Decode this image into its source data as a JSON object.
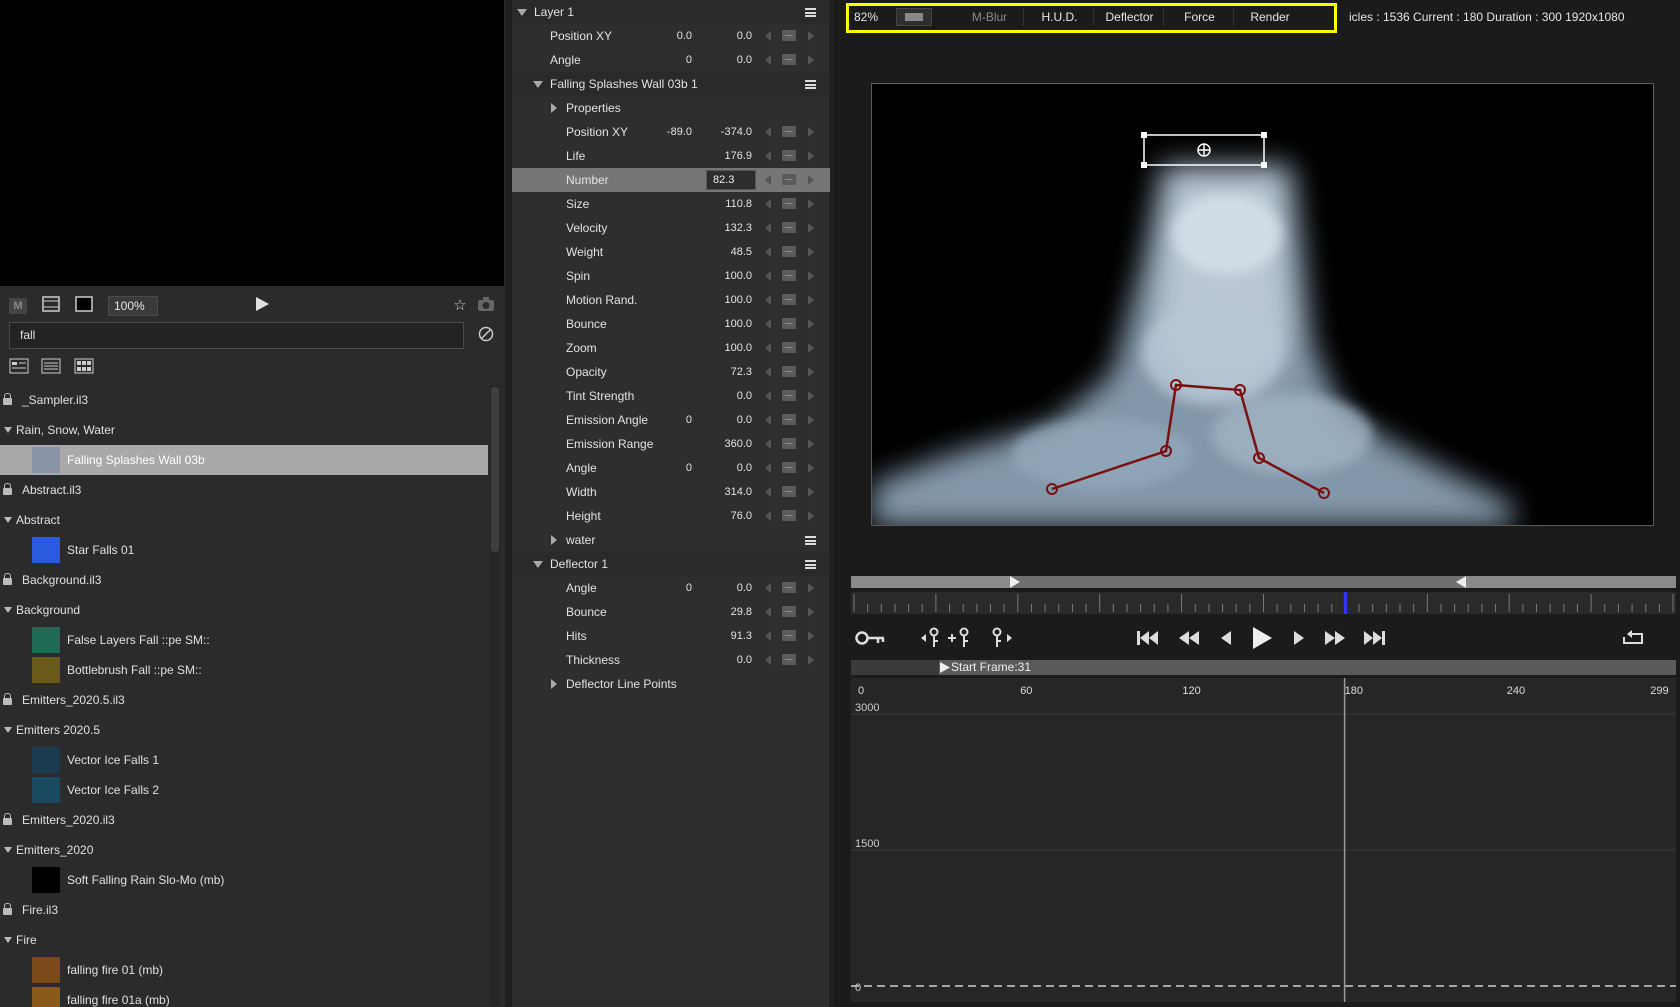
{
  "left_panel": {
    "zoom": "100%",
    "search_value": "fall",
    "tree": [
      {
        "kind": "lib",
        "label": "_Sampler.il3"
      },
      {
        "kind": "group",
        "label": "Rain, Snow, Water"
      },
      {
        "kind": "item",
        "label": "Falling Splashes Wall 03b",
        "selected": true,
        "thumb": "#8a96a8"
      },
      {
        "kind": "lib",
        "label": "Abstract.il3"
      },
      {
        "kind": "group",
        "label": "Abstract"
      },
      {
        "kind": "item",
        "label": "Star Falls 01",
        "thumb": "#2a5adf"
      },
      {
        "kind": "lib",
        "label": "Background.il3"
      },
      {
        "kind": "group",
        "label": "Background"
      },
      {
        "kind": "item",
        "label": "False Layers Fall  ::pe SM::",
        "thumb": "#1f6a55"
      },
      {
        "kind": "item",
        "label": "Bottlebrush Fall  ::pe SM::",
        "thumb": "#6a5a1a"
      },
      {
        "kind": "lib",
        "label": "Emitters_2020.5.il3"
      },
      {
        "kind": "group",
        "label": "Emitters 2020.5"
      },
      {
        "kind": "item",
        "label": "Vector Ice Falls 1",
        "thumb": "#1a3a50"
      },
      {
        "kind": "item",
        "label": "Vector Ice Falls 2",
        "thumb": "#1a4a60"
      },
      {
        "kind": "lib",
        "label": "Emitters_2020.il3"
      },
      {
        "kind": "group",
        "label": "Emitters_2020"
      },
      {
        "kind": "item",
        "label": "Soft Falling Rain Slo-Mo (mb)",
        "thumb": "#000000"
      },
      {
        "kind": "lib",
        "label": "Fire.il3"
      },
      {
        "kind": "group",
        "label": "Fire"
      },
      {
        "kind": "item",
        "label": "falling fire 01 (mb)",
        "thumb": "#7a4a1a"
      },
      {
        "kind": "item",
        "label": "falling fire 01a (mb)",
        "thumb": "#8a5a1a"
      }
    ]
  },
  "properties": [
    {
      "type": "header",
      "label": "Layer 1",
      "indent": 0,
      "expanded": true
    },
    {
      "type": "prop",
      "label": "Position XY",
      "v1": "0.0",
      "v2": "0.0",
      "indent": 1
    },
    {
      "type": "prop",
      "label": "Angle",
      "v1": "0",
      "v2": "0.0",
      "indent": 1
    },
    {
      "type": "header",
      "label": "Falling Splashes Wall 03b 1",
      "indent": 1,
      "expanded": true
    },
    {
      "type": "group",
      "label": "Properties",
      "indent": 2,
      "expanded": false
    },
    {
      "type": "prop",
      "label": "Position XY",
      "v1": "-89.0",
      "v2": "-374.0",
      "indent": 2
    },
    {
      "type": "prop",
      "label": "Life",
      "v2": "176.9",
      "indent": 2
    },
    {
      "type": "prop",
      "label": "Number",
      "v2": "82.3",
      "indent": 2,
      "selected": true
    },
    {
      "type": "prop",
      "label": "Size",
      "v2": "110.8",
      "indent": 2
    },
    {
      "type": "prop",
      "label": "Velocity",
      "v2": "132.3",
      "indent": 2
    },
    {
      "type": "prop",
      "label": "Weight",
      "v2": "48.5",
      "indent": 2
    },
    {
      "type": "prop",
      "label": "Spin",
      "v2": "100.0",
      "indent": 2
    },
    {
      "type": "prop",
      "label": "Motion Rand.",
      "v2": "100.0",
      "indent": 2
    },
    {
      "type": "prop",
      "label": "Bounce",
      "v2": "100.0",
      "indent": 2
    },
    {
      "type": "prop",
      "label": "Zoom",
      "v2": "100.0",
      "indent": 2
    },
    {
      "type": "prop",
      "label": "Opacity",
      "v2": "72.3",
      "indent": 2
    },
    {
      "type": "prop",
      "label": "Tint Strength",
      "v2": "0.0",
      "indent": 2
    },
    {
      "type": "prop",
      "label": "Emission Angle",
      "v1": "0",
      "v2": "0.0",
      "indent": 2
    },
    {
      "type": "prop",
      "label": "Emission Range",
      "v2": "360.0",
      "indent": 2
    },
    {
      "type": "prop",
      "label": "Angle",
      "v1": "0",
      "v2": "0.0",
      "indent": 2
    },
    {
      "type": "prop",
      "label": "Width",
      "v2": "314.0",
      "indent": 2
    },
    {
      "type": "prop",
      "label": "Height",
      "v2": "76.0",
      "indent": 2
    },
    {
      "type": "groupmenu",
      "label": "water",
      "indent": 2,
      "expanded": false
    },
    {
      "type": "header",
      "label": "Deflector 1",
      "indent": 1,
      "expanded": true
    },
    {
      "type": "prop",
      "label": "Angle",
      "v1": "0",
      "v2": "0.0",
      "indent": 2
    },
    {
      "type": "prop",
      "label": "Bounce",
      "v2": "29.8",
      "indent": 2
    },
    {
      "type": "prop",
      "label": "Hits",
      "v2": "91.3",
      "indent": 2
    },
    {
      "type": "prop",
      "label": "Thickness",
      "v2": "0.0",
      "indent": 2
    },
    {
      "type": "group",
      "label": "Deflector Line Points",
      "indent": 2,
      "expanded": false
    }
  ],
  "viewer": {
    "toolbar": {
      "zoom": "82%",
      "buttons": [
        "M-Blur",
        "H.U.D.",
        "Deflector",
        "Force",
        "Render"
      ]
    },
    "stats": "icles : 1536    Current : 180    Duration : 300    1920x1080",
    "start_frame": "Start Frame:31",
    "current_frame": 180,
    "duration": 300,
    "graph": {
      "x_ticks": [
        "0",
        "60",
        "120",
        "180",
        "240",
        "299"
      ],
      "y_ticks": [
        "3000",
        "1500",
        "0"
      ]
    }
  },
  "colors": {
    "highlight": "#ffff00",
    "deflector_line": "#7a1010",
    "playhead": "#3333ff"
  }
}
